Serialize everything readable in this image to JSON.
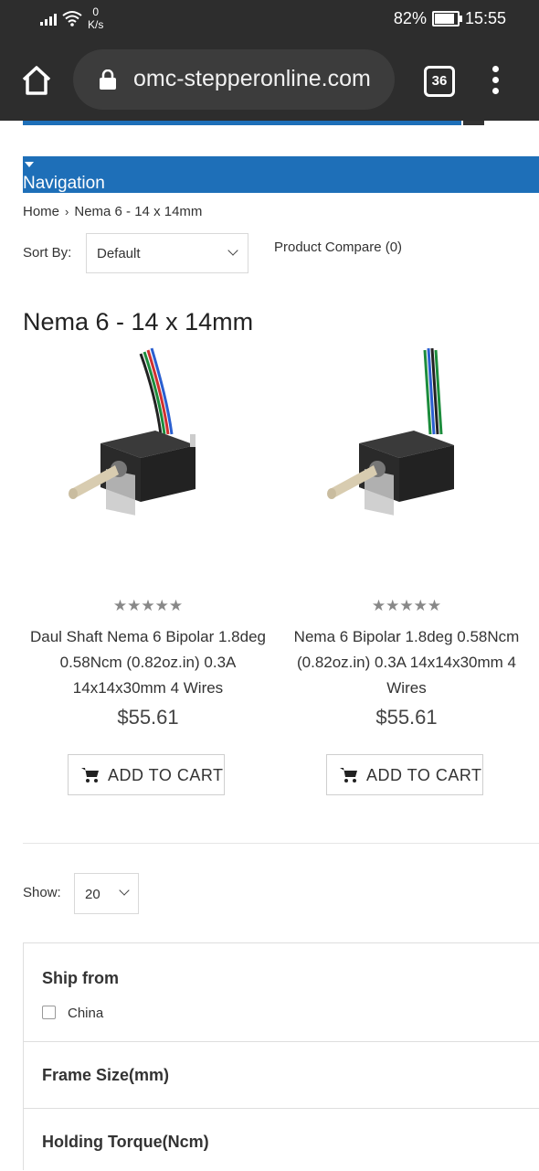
{
  "status_bar": {
    "net_speed_value": "0",
    "net_speed_unit": "K/s",
    "battery": "82%",
    "battery_level": 0.82,
    "time": "15:55"
  },
  "browser": {
    "url": "omc-stepperonline.com",
    "tab_count": "36"
  },
  "navigation": {
    "label": "Navigation"
  },
  "breadcrumb": {
    "home": "Home",
    "separator": "›",
    "current": "Nema 6 - 14 x 14mm"
  },
  "sort": {
    "label": "Sort By:",
    "value": "Default"
  },
  "compare": {
    "label": "Product Compare (0)"
  },
  "page_title": "Nema 6 - 14 x 14mm",
  "products": [
    {
      "name": "Daul Shaft Nema 6 Bipolar 1.8deg 0.58Ncm (0.82oz.in) 0.3A 14x14x30mm 4 Wires",
      "price": "$55.61",
      "stars": "★★★★★",
      "rating": 0,
      "cart_label": "ADD TO CART"
    },
    {
      "name": "Nema 6 Bipolar 1.8deg 0.58Ncm (0.82oz.in) 0.3A 14x14x30mm 4 Wires",
      "price": "$55.61",
      "stars": "★★★★★",
      "rating": 0,
      "cart_label": "ADD TO CART"
    }
  ],
  "show": {
    "label": "Show:",
    "value": "20"
  },
  "filters": [
    {
      "title": "Ship from",
      "options": [
        "China"
      ]
    },
    {
      "title": "Frame Size(mm)"
    },
    {
      "title": "Holding Torque(Ncm)"
    }
  ],
  "colors": {
    "accent": "#1e6fb8",
    "status_bar": "#2d2d2d",
    "url_box": "#3c3c3c"
  },
  "icons": {
    "home": "home-icon",
    "lock": "lock-icon",
    "tabs": "tab-count-icon",
    "menu": "overflow-menu-icon",
    "cart": "cart-icon",
    "chevron": "chevron-down-icon"
  }
}
